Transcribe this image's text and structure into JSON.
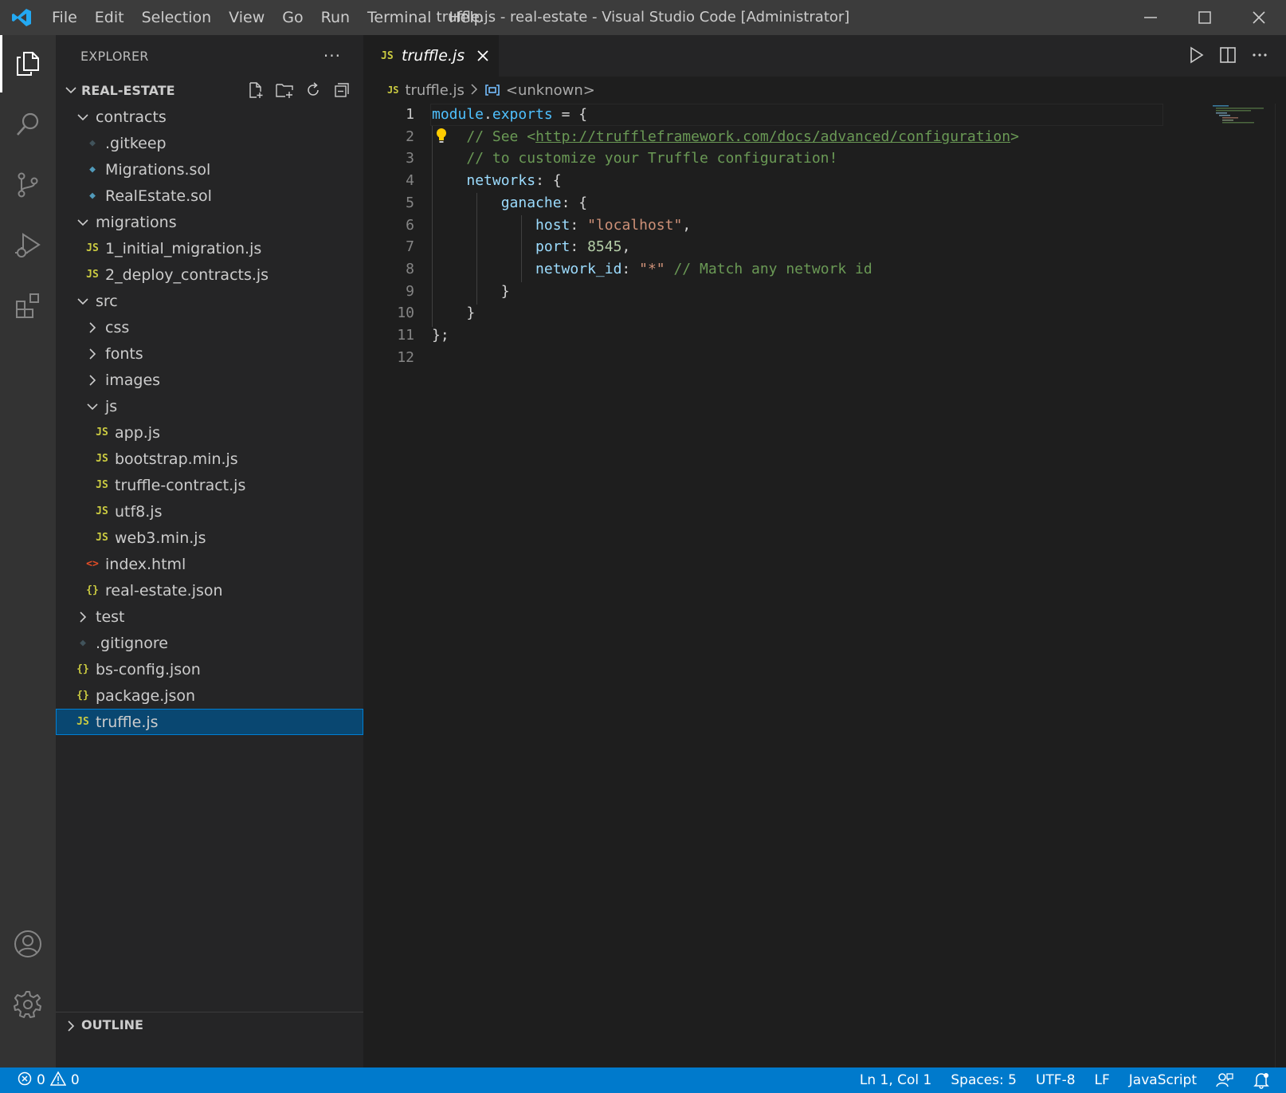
{
  "titlebar": {
    "menu": [
      "File",
      "Edit",
      "Selection",
      "View",
      "Go",
      "Run",
      "Terminal",
      "Help"
    ],
    "window_title": "truffle.js - real-estate - Visual Studio Code [Administrator]"
  },
  "activity": {
    "items": [
      "explorer-icon",
      "search-icon",
      "source-control-icon",
      "run-debug-icon",
      "extensions-icon"
    ],
    "bottom": [
      "account-icon",
      "settings-gear-icon"
    ]
  },
  "sidebar": {
    "title": "EXPLORER",
    "more": "···",
    "project": "REAL-ESTATE",
    "outline": "OUTLINE",
    "tree": [
      {
        "label": "contracts",
        "type": "folder-open",
        "depth": 1
      },
      {
        "label": ".gitkeep",
        "type": "git",
        "depth": 2
      },
      {
        "label": "Migrations.sol",
        "type": "sol",
        "depth": 2
      },
      {
        "label": "RealEstate.sol",
        "type": "sol",
        "depth": 2
      },
      {
        "label": "migrations",
        "type": "folder-open",
        "depth": 1
      },
      {
        "label": "1_initial_migration.js",
        "type": "js",
        "depth": 2
      },
      {
        "label": "2_deploy_contracts.js",
        "type": "js",
        "depth": 2
      },
      {
        "label": "src",
        "type": "folder-open",
        "depth": 1
      },
      {
        "label": "css",
        "type": "folder-closed",
        "depth": 2
      },
      {
        "label": "fonts",
        "type": "folder-closed",
        "depth": 2
      },
      {
        "label": "images",
        "type": "folder-closed",
        "depth": 2
      },
      {
        "label": "js",
        "type": "folder-open",
        "depth": 2
      },
      {
        "label": "app.js",
        "type": "js",
        "depth": 3
      },
      {
        "label": "bootstrap.min.js",
        "type": "js",
        "depth": 3
      },
      {
        "label": "truffle-contract.js",
        "type": "js",
        "depth": 3
      },
      {
        "label": "utf8.js",
        "type": "js",
        "depth": 3
      },
      {
        "label": "web3.min.js",
        "type": "js",
        "depth": 3
      },
      {
        "label": "index.html",
        "type": "html",
        "depth": 2
      },
      {
        "label": "real-estate.json",
        "type": "json",
        "depth": 2
      },
      {
        "label": "test",
        "type": "folder-closed",
        "depth": 1
      },
      {
        "label": ".gitignore",
        "type": "git",
        "depth": 1
      },
      {
        "label": "bs-config.json",
        "type": "json",
        "depth": 1
      },
      {
        "label": "package.json",
        "type": "json",
        "depth": 1
      },
      {
        "label": "truffle.js",
        "type": "js",
        "depth": 1,
        "selected": true
      }
    ]
  },
  "editor": {
    "tab_name": "truffle.js",
    "tab_js": "JS",
    "breadcrumb_file": "truffle.js",
    "breadcrumb_symbol": "<unknown>",
    "lines": [
      [
        [
          "t-var",
          "module"
        ],
        [
          "t-pun",
          "."
        ],
        [
          "t-var",
          "exports"
        ],
        [
          "t-pun",
          " = {"
        ]
      ],
      [
        [
          "t-pun",
          "    "
        ],
        [
          "t-com",
          "// See <"
        ],
        [
          "t-link",
          "http://truffleframework.com/docs/advanced/configuration"
        ],
        [
          "t-com",
          ">"
        ]
      ],
      [
        [
          "t-pun",
          "    "
        ],
        [
          "t-com",
          "// to customize your Truffle configuration!"
        ]
      ],
      [
        [
          "t-pun",
          "    "
        ],
        [
          "t-prop",
          "networks"
        ],
        [
          "t-pun",
          ": {"
        ]
      ],
      [
        [
          "t-pun",
          "        "
        ],
        [
          "t-prop",
          "ganache"
        ],
        [
          "t-pun",
          ": {"
        ]
      ],
      [
        [
          "t-pun",
          "            "
        ],
        [
          "t-prop",
          "host"
        ],
        [
          "t-pun",
          ": "
        ],
        [
          "t-str",
          "\"localhost\""
        ],
        [
          "t-pun",
          ","
        ]
      ],
      [
        [
          "t-pun",
          "            "
        ],
        [
          "t-prop",
          "port"
        ],
        [
          "t-pun",
          ": "
        ],
        [
          "t-num",
          "8545"
        ],
        [
          "t-pun",
          ","
        ]
      ],
      [
        [
          "t-pun",
          "            "
        ],
        [
          "t-prop",
          "network_id"
        ],
        [
          "t-pun",
          ": "
        ],
        [
          "t-str",
          "\"*\""
        ],
        [
          "t-pun",
          " "
        ],
        [
          "t-com",
          "// Match any network id"
        ]
      ],
      [
        [
          "t-pun",
          "        }"
        ]
      ],
      [
        [
          "t-pun",
          "    }"
        ]
      ],
      [
        [
          "t-pun",
          "};"
        ]
      ],
      [
        [
          "t-pun",
          ""
        ]
      ]
    ]
  },
  "status": {
    "errors": "0",
    "warnings": "0",
    "position": "Ln 1, Col 1",
    "spaces": "Spaces: 5",
    "encoding": "UTF-8",
    "eol": "LF",
    "language": "JavaScript"
  }
}
